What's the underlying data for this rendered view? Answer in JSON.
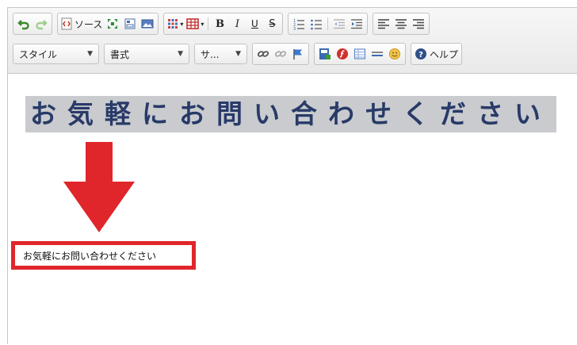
{
  "toolbar": {
    "source_label": "ソース",
    "style_combo": "スタイル",
    "format_combo": "書式",
    "size_combo": "サ...",
    "help_label": "ヘルプ",
    "bold": "B",
    "italic": "I",
    "underline": "U",
    "strike": "S"
  },
  "content": {
    "heading_text": "お気軽にお問い合わせください",
    "result_text": "お気軽にお問い合わせください"
  },
  "colors": {
    "accent_red": "#e0262a",
    "heading_text": "#283a68",
    "heading_highlight": "#c9cbce"
  }
}
